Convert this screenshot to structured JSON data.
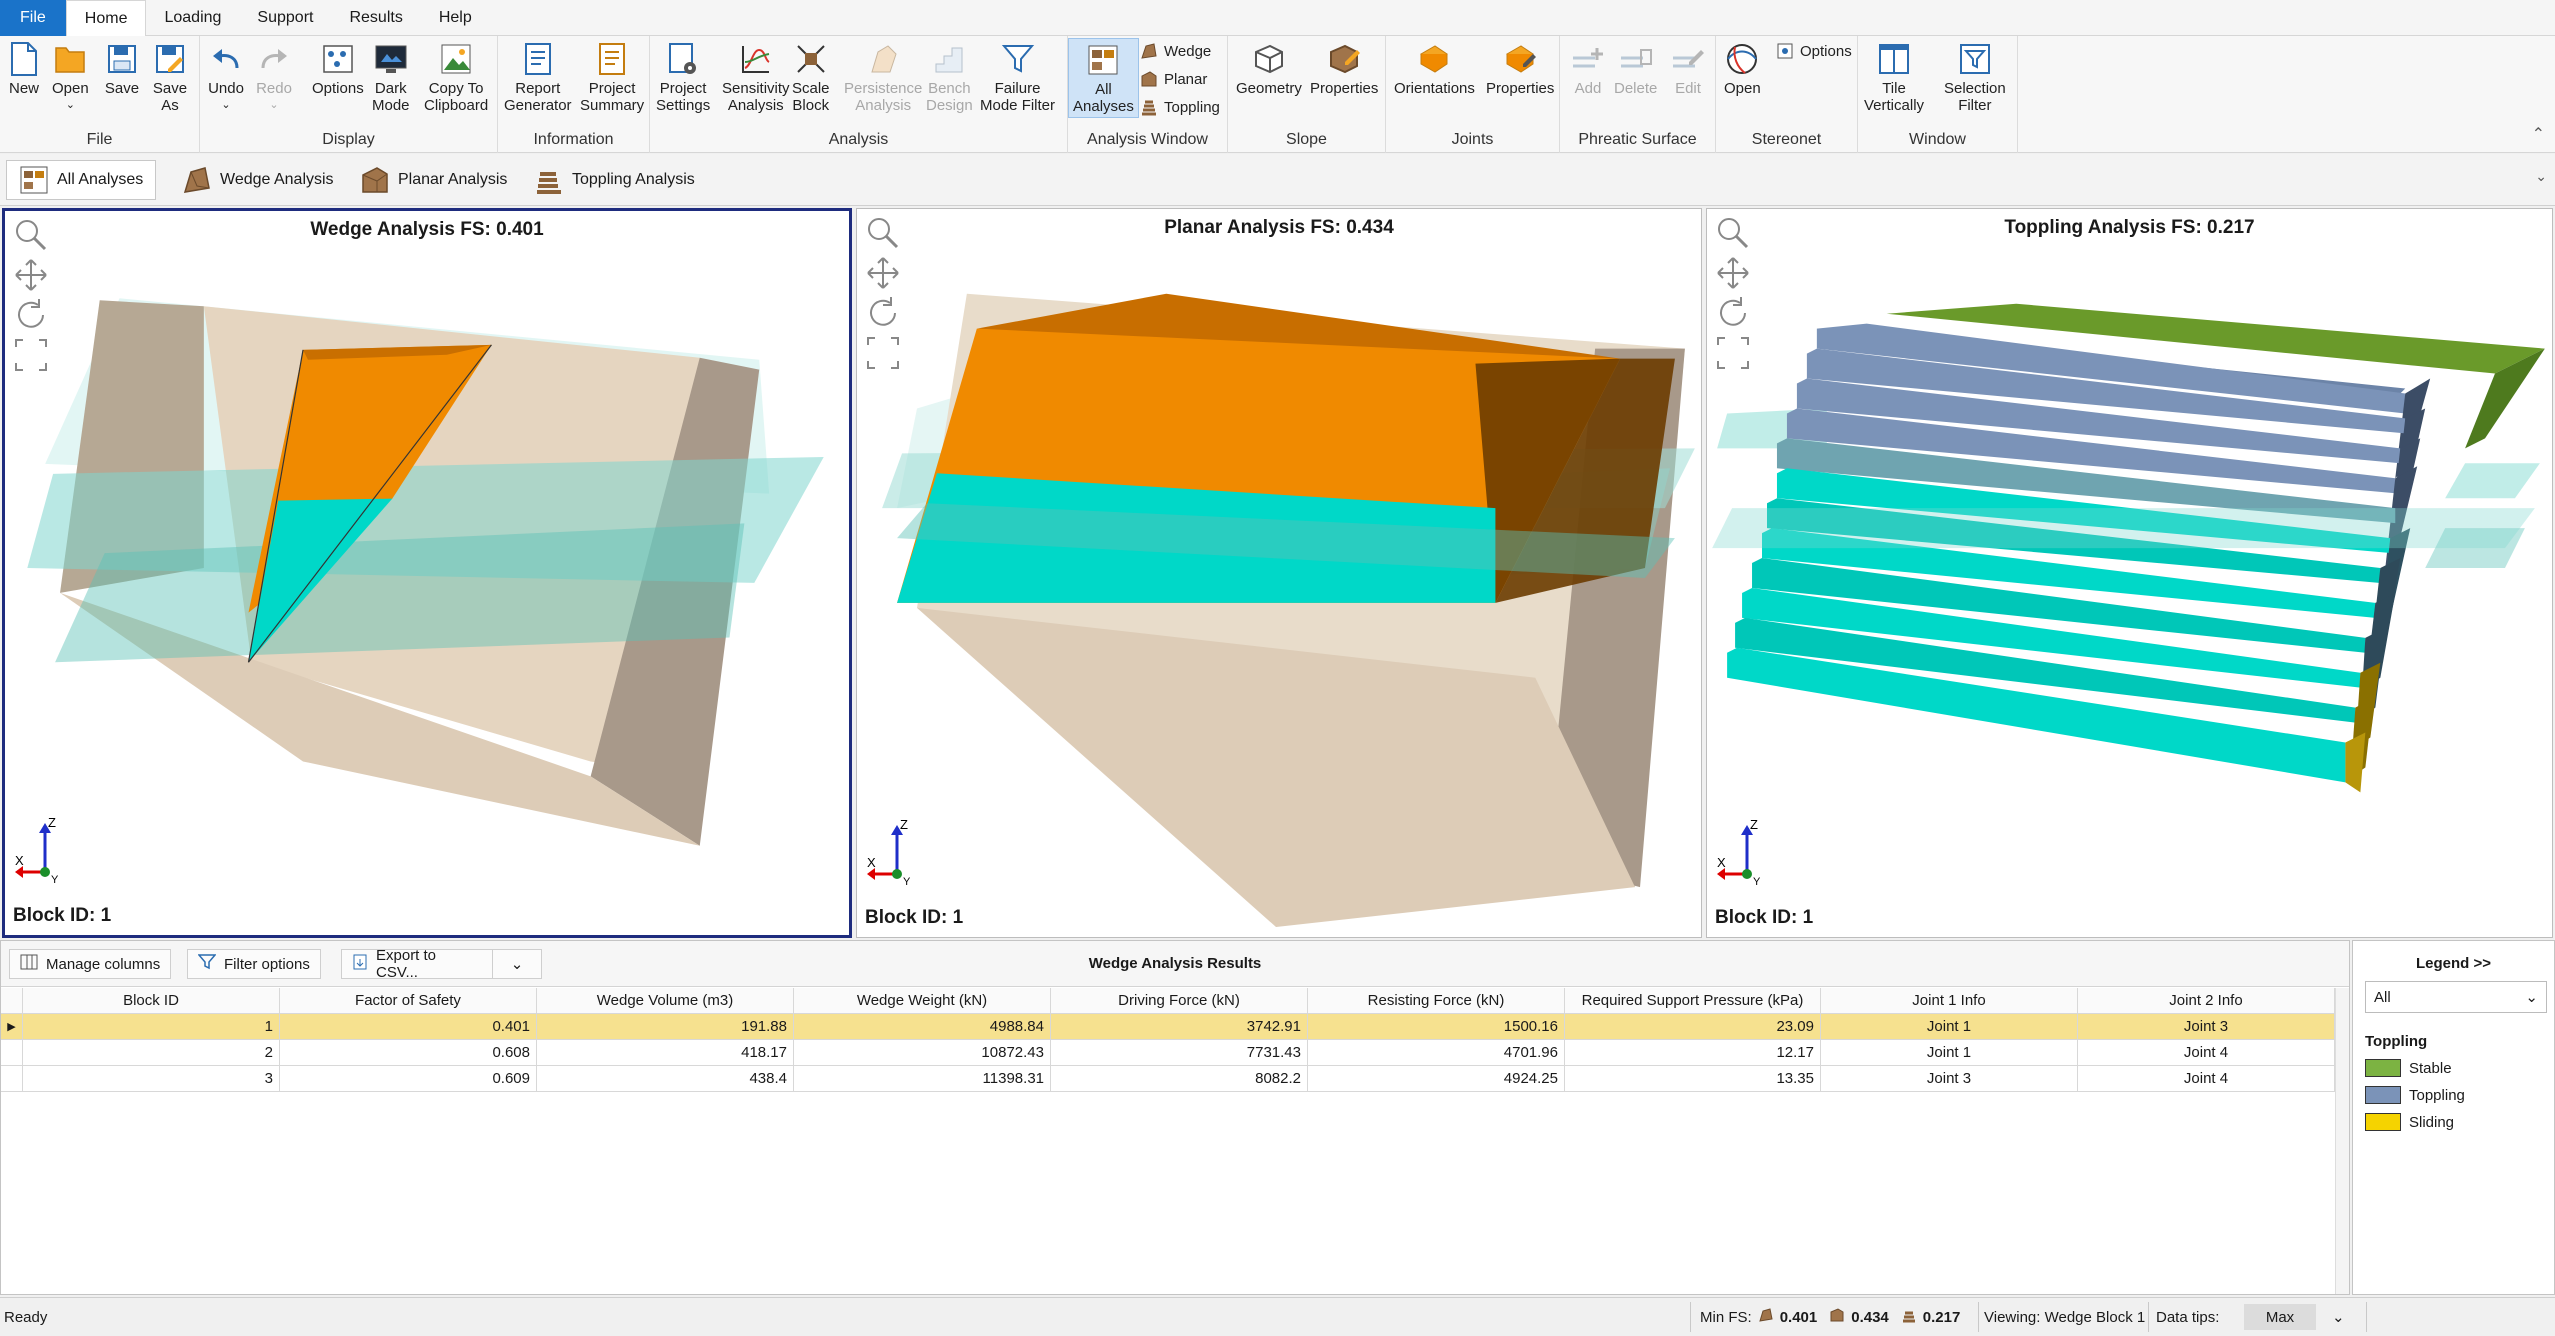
{
  "menu": {
    "file": "File",
    "home": "Home",
    "loading": "Loading",
    "support": "Support",
    "results": "Results",
    "help": "Help"
  },
  "ribbon": {
    "file_group": {
      "label": "File",
      "new": "New",
      "open": "Open",
      "save": "Save",
      "save_as_1": "Save",
      "save_as_2": "As"
    },
    "display_group": {
      "label": "Display",
      "undo": "Undo",
      "redo": "Redo",
      "options": "Options",
      "dark_1": "Dark",
      "dark_2": "Mode",
      "copy_1": "Copy To",
      "copy_2": "Clipboard"
    },
    "information_group": {
      "label": "Information",
      "report_1": "Report",
      "report_2": "Generator",
      "summary_1": "Project",
      "summary_2": "Summary"
    },
    "analysis_group": {
      "label": "Analysis",
      "settings_1": "Project",
      "settings_2": "Settings",
      "sensitivity_1": "Sensitivity",
      "sensitivity_2": "Analysis",
      "scale_1": "Scale",
      "scale_2": "Block",
      "persistence_1": "Persistence",
      "persistence_2": "Analysis",
      "bench_1": "Bench",
      "bench_2": "Design",
      "failure_1": "Failure",
      "failure_2": "Mode Filter"
    },
    "analysis_window_group": {
      "label": "Analysis Window",
      "all_1": "All",
      "all_2": "Analyses",
      "wedge": "Wedge",
      "planar": "Planar",
      "toppling": "Toppling"
    },
    "slope_group": {
      "label": "Slope",
      "geometry": "Geometry",
      "properties": "Properties"
    },
    "joints_group": {
      "label": "Joints",
      "orientations": "Orientations",
      "properties": "Properties"
    },
    "phreatic_group": {
      "label": "Phreatic Surface",
      "add": "Add",
      "delete": "Delete",
      "edit": "Edit"
    },
    "stereonet_group": {
      "label": "Stereonet",
      "open": "Open",
      "options": "Options"
    },
    "window_group": {
      "label": "Window",
      "tile_1": "Tile",
      "tile_2": "Vertically",
      "selection_1": "Selection",
      "selection_2": "Filter"
    }
  },
  "tabs": {
    "all": "All Analyses",
    "wedge": "Wedge Analysis",
    "planar": "Planar Analysis",
    "toppling": "Toppling Analysis"
  },
  "viewports": {
    "wedge": {
      "title": "Wedge Analysis FS: 0.401",
      "block": "Block ID: 1"
    },
    "planar": {
      "title": "Planar Analysis FS: 0.434",
      "block": "Block ID: 1"
    },
    "toppling": {
      "title": "Toppling Analysis FS: 0.217",
      "block": "Block ID: 1"
    },
    "axes": {
      "z": "Z",
      "x": "X",
      "y": "Y"
    }
  },
  "results": {
    "manage_columns": "Manage columns",
    "filter_options": "Filter options",
    "export": "Export to CSV...",
    "title": "Wedge Analysis Results",
    "columns": [
      "Block ID",
      "Factor of Safety",
      "Wedge Volume (m3)",
      "Wedge Weight (kN)",
      "Driving Force (kN)",
      "Resisting Force (kN)",
      "Required Support Pressure (kPa)",
      "Joint 1 Info",
      "Joint 2 Info"
    ],
    "rows": [
      [
        "1",
        "0.401",
        "191.88",
        "4988.84",
        "3742.91",
        "1500.16",
        "23.09",
        "Joint 1",
        "Joint 3"
      ],
      [
        "2",
        "0.608",
        "418.17",
        "10872.43",
        "7731.43",
        "4701.96",
        "12.17",
        "Joint 1",
        "Joint 4"
      ],
      [
        "3",
        "0.609",
        "438.4",
        "11398.31",
        "8082.2",
        "4924.25",
        "13.35",
        "Joint 3",
        "Joint 4"
      ]
    ]
  },
  "legend": {
    "title": "Legend >>",
    "filter": "All",
    "heading": "Toppling",
    "items": [
      {
        "label": "Stable",
        "color": "#7cb342"
      },
      {
        "label": "Toppling",
        "color": "#7b93b8"
      },
      {
        "label": "Sliding",
        "color": "#f5d300"
      }
    ]
  },
  "status": {
    "ready": "Ready",
    "min_fs": "Min FS:",
    "fs_wedge": "0.401",
    "fs_planar": "0.434",
    "fs_toppling": "0.217",
    "viewing": "Viewing: Wedge Block 1",
    "data_tips": "Data tips:",
    "data_tips_value": "Max"
  },
  "colors": {
    "accent": "#1a73c9",
    "selected_row": "#f6e18f",
    "active_viewport": "#1e2c7e",
    "slope_rock": "#e3d2bc",
    "wedge_orange": "#f08a00",
    "cyan_face": "#00d8c8"
  }
}
